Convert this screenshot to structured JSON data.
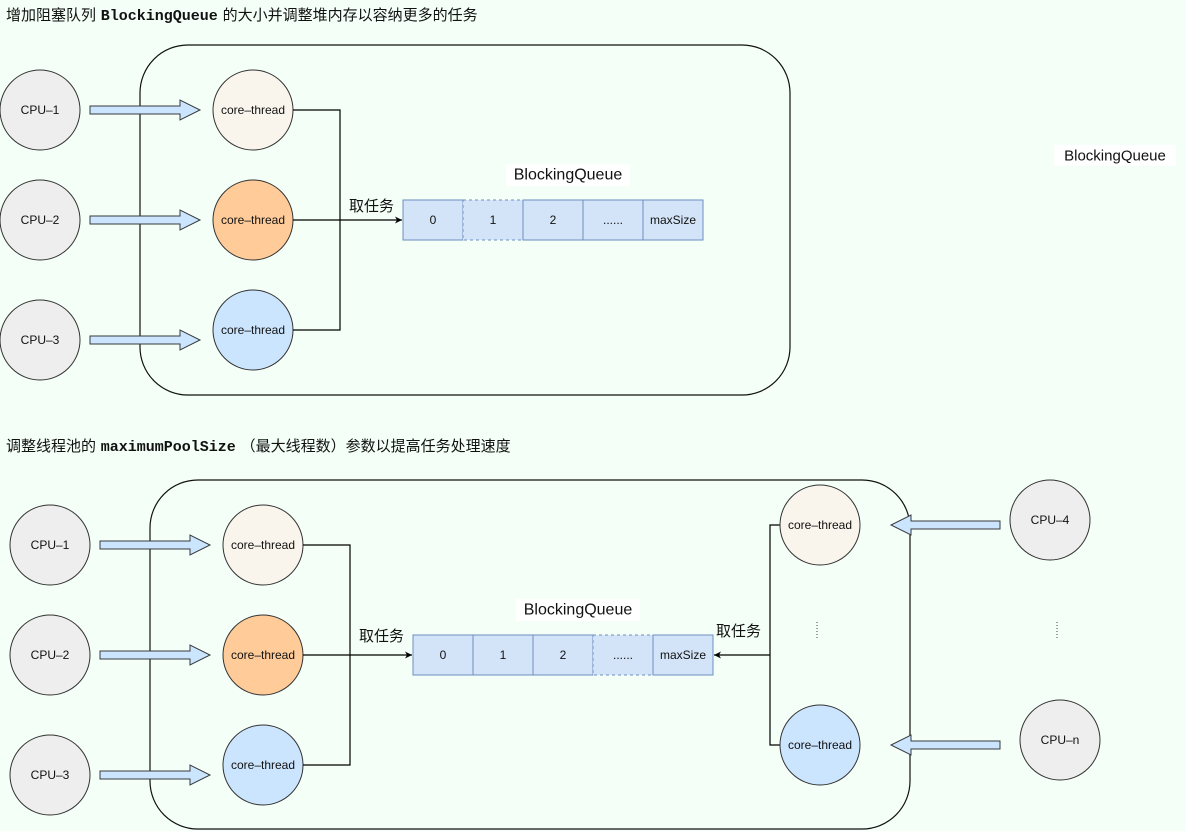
{
  "diagram1": {
    "heading_prefix": "增加阻塞队列 ",
    "heading_code": "BlockingQueue",
    "heading_suffix": " 的大小并调整堆内存以容纳更多的任务",
    "cpus": [
      "CPU–1",
      "CPU–2",
      "CPU–3"
    ],
    "threads": [
      {
        "label": "core–thread",
        "color": "cream"
      },
      {
        "label": "core–thread",
        "color": "orange"
      },
      {
        "label": "core–thread",
        "color": "blue"
      }
    ],
    "take_task_label": "取任务",
    "queue_title": "BlockingQueue",
    "queue_cells": [
      "0",
      "1",
      "2",
      "......",
      "maxSize"
    ],
    "side_label": "BlockingQueue"
  },
  "diagram2": {
    "heading_prefix": "调整线程池的 ",
    "heading_code": "maximumPoolSize",
    "heading_suffix": "  （最大线程数）参数以提高任务处理速度",
    "left_cpus": [
      "CPU–1",
      "CPU–2",
      "CPU–3"
    ],
    "left_threads": [
      {
        "label": "core–thread",
        "color": "cream"
      },
      {
        "label": "core–thread",
        "color": "orange"
      },
      {
        "label": "core–thread",
        "color": "blue"
      }
    ],
    "right_threads": [
      {
        "label": "core–thread",
        "color": "cream"
      },
      {
        "label": "core–thread",
        "color": "blue"
      }
    ],
    "right_cpus": [
      "CPU–4",
      "CPU–n"
    ],
    "take_task_left_label": "取任务",
    "take_task_right_label": "取任务",
    "queue_title": "BlockingQueue",
    "queue_cells": [
      "0",
      "1",
      "2",
      "......",
      "maxSize"
    ]
  },
  "colors": {
    "background": "#f4fff7",
    "cpu_fill": "#eeeeee",
    "thread_cream": "#f9f5ed",
    "thread_orange": "#ffcc99",
    "thread_blue": "#cce5ff",
    "queue_cell_fill": "#d4e4f8",
    "queue_cell_stroke": "#6c8ebf",
    "arrow_fill": "#cce5ff"
  }
}
